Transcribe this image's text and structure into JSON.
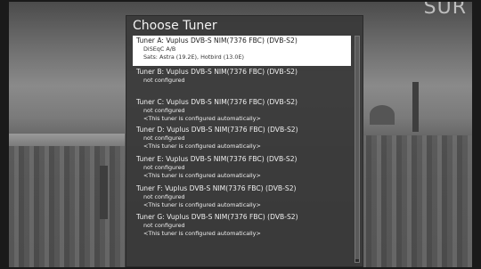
{
  "dialog": {
    "title": "Choose Tuner"
  },
  "tuners": [
    {
      "name": "Tuner A: Vuplus DVB-S NIM(7376 FBC) (DVB-S2)",
      "lines": [
        "DiSEqC A/B",
        "Sats: Astra (19.2E), Hotbird (13.0E)"
      ],
      "selected": true
    },
    {
      "name": "Tuner B: Vuplus DVB-S NIM(7376 FBC) (DVB-S2)",
      "lines": [
        "not configured"
      ],
      "selected": false
    },
    {
      "name": "Tuner C: Vuplus DVB-S NIM(7376 FBC) (DVB-S2)",
      "lines": [
        "not configured",
        "<This tuner is configured automatically>"
      ],
      "selected": false
    },
    {
      "name": "Tuner D: Vuplus DVB-S NIM(7376 FBC) (DVB-S2)",
      "lines": [
        "not configured",
        "<This tuner is configured automatically>"
      ],
      "selected": false
    },
    {
      "name": "Tuner E: Vuplus DVB-S NIM(7376 FBC) (DVB-S2)",
      "lines": [
        "not configured",
        "<This tuner is configured automatically>"
      ],
      "selected": false
    },
    {
      "name": "Tuner F: Vuplus DVB-S NIM(7376 FBC) (DVB-S2)",
      "lines": [
        "not configured",
        "<This tuner is configured automatically>"
      ],
      "selected": false
    },
    {
      "name": "Tuner G: Vuplus DVB-S NIM(7376 FBC) (DVB-S2)",
      "lines": [
        "not configured",
        "<This tuner is configured automatically>"
      ],
      "selected": false
    }
  ],
  "colors": {
    "dialog_bg": "#3a3a3a",
    "selected_bg": "#ffffff",
    "text": "#f0f0f0"
  }
}
